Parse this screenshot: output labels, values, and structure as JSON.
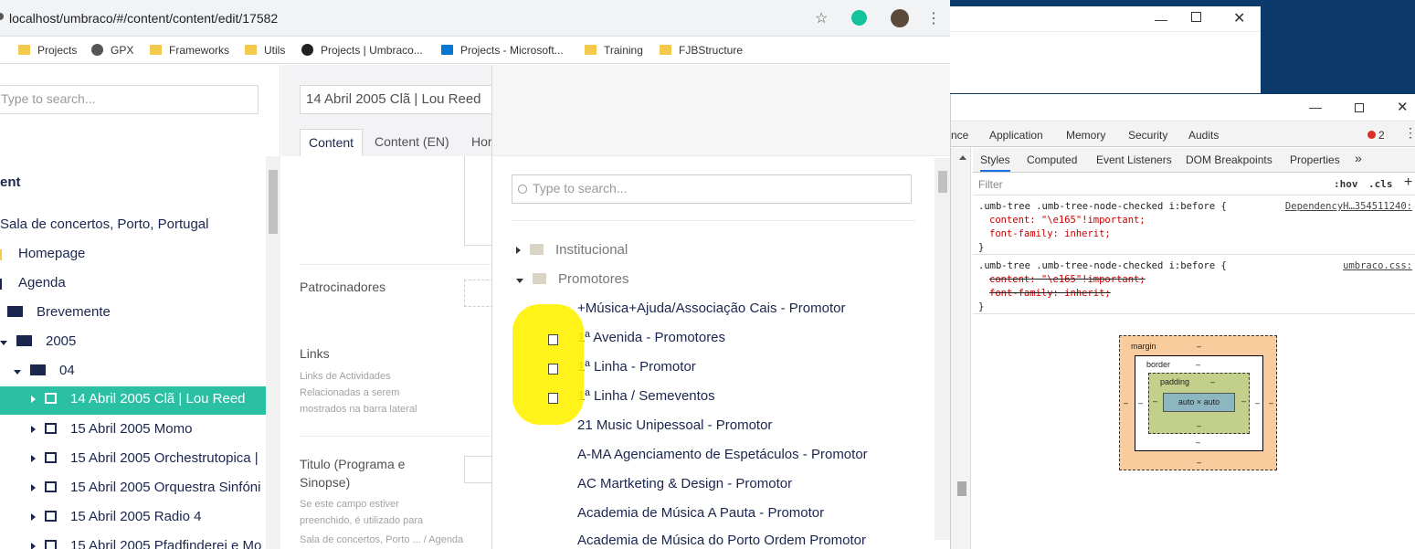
{
  "browser": {
    "url": "localhost/umbraco/#/content/content/edit/17582",
    "bookmarks": [
      "Projects",
      "GPX",
      "Frameworks",
      "Utils",
      "Projects | Umbraco...",
      "Projects - Microsoft...",
      "Training",
      "FJBStructure"
    ]
  },
  "tree": {
    "search_placeholder": "Type to search...",
    "section_label": "ent",
    "nodes": [
      "Sala de concertos, Porto, Portugal",
      "Homepage",
      "Agenda",
      "Brevemente",
      "2005",
      "04",
      "14 Abril 2005 Clã | Lou Reed",
      "15 Abril 2005 Momo",
      "15 Abril 2005 Orchestrutopica |",
      "15 Abril 2005 Orquestra Sinfóni",
      "15 Abril 2005 Radio 4",
      "15 Abril 2005 Pfadfinderei e Mo"
    ]
  },
  "editor": {
    "title": "14 Abril 2005 Clã | Lou Reed",
    "tabs": [
      "Content",
      "Content (EN)",
      "Hor"
    ],
    "props": {
      "patrocinadores": "Patrocinadores",
      "links": "Links",
      "links_desc": "Links de Actividades Relacionadas a serem mostrados na barra lateral",
      "titulo": "Titulo (Programa e Sinopse)",
      "titulo_desc": "Se este campo estiver preenchido, é utilizado para"
    },
    "footer": "Sala de concertos, Porto ... / Agenda"
  },
  "picker": {
    "search_placeholder": "Type to search...",
    "folders": [
      "Institucional",
      "Promotores"
    ],
    "items": [
      "+Música+Ajuda/Associação Cais - Promotor",
      "1ª Avenida - Promotores",
      "1ª Linha - Promotor",
      "1ª Linha / Semeventos",
      "21 Music Unipessoal - Promotor",
      "A-MA Agenciamento de Espetáculos - Promotor",
      "AC Martketing & Design - Promotor",
      "Academia de Música A Pauta - Promotor",
      "Academia de Música do Porto Ordem Promotor"
    ]
  },
  "devtools": {
    "tabs": [
      "nce",
      "Application",
      "Memory",
      "Security",
      "Audits"
    ],
    "error_count": "2",
    "subtabs": [
      "Styles",
      "Computed",
      "Event Listeners",
      "DOM Breakpoints",
      "Properties",
      "»"
    ],
    "filter_placeholder": "Filter",
    "hov": ":hov",
    "cls": ".cls",
    "rule1": {
      "selector": ".umb-tree .umb-tree-node-checked i:before {",
      "source": "DependencyH…354511240:",
      "line1": "content: \"\\e165\"!important;",
      "line2": "font-family: inherit;",
      "close": "}"
    },
    "rule2": {
      "selector": ".umb-tree .umb-tree-node-checked i:before {",
      "source": "umbraco.css:",
      "line1": "content: \"\\e165\"!important;",
      "line2": "font-family: inherit;",
      "close": "}"
    },
    "boxmodel": {
      "margin": "margin",
      "border": "border",
      "padding": "padding",
      "content": "auto × auto",
      "dash": "–"
    }
  },
  "colors": {
    "selected": "#2bc0a4",
    "navy": "#1b264f",
    "highlight": "#fff200"
  }
}
